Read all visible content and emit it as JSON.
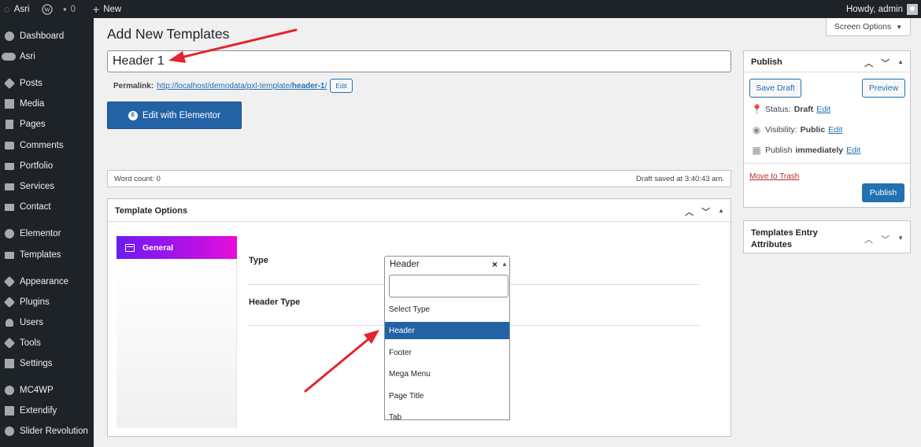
{
  "admin_bar": {
    "site_name": "Asri",
    "comment_count": "0",
    "new_label": "New",
    "howdy": "Howdy, admin"
  },
  "sidebar": {
    "items": [
      {
        "label": "Dashboard",
        "icon": "dashboard-icon"
      },
      {
        "label": "Asri",
        "icon": "toggle-icon"
      },
      {
        "label": "Posts",
        "icon": "pin-icon"
      },
      {
        "label": "Media",
        "icon": "media-icon"
      },
      {
        "label": "Pages",
        "icon": "pages-icon"
      },
      {
        "label": "Comments",
        "icon": "comments-icon"
      },
      {
        "label": "Portfolio",
        "icon": "folder-icon"
      },
      {
        "label": "Services",
        "icon": "folder-icon"
      },
      {
        "label": "Contact",
        "icon": "mail-icon"
      },
      {
        "label": "Elementor",
        "icon": "elementor-icon"
      },
      {
        "label": "Templates",
        "icon": "folder-icon"
      },
      {
        "label": "Appearance",
        "icon": "brush-icon"
      },
      {
        "label": "Plugins",
        "icon": "plug-icon"
      },
      {
        "label": "Users",
        "icon": "users-icon"
      },
      {
        "label": "Tools",
        "icon": "wrench-icon"
      },
      {
        "label": "Settings",
        "icon": "settings-icon"
      },
      {
        "label": "MC4WP",
        "icon": "mc4wp-icon"
      },
      {
        "label": "Extendify",
        "icon": "extendify-icon"
      },
      {
        "label": "Slider Revolution",
        "icon": "refresh-icon"
      }
    ]
  },
  "page": {
    "title": "Add New Templates",
    "screen_options": "Screen Options",
    "post_title_value": "Header 1",
    "permalink_label": "Permalink:",
    "permalink_base": "http://localhost/demodata/pxl-template/",
    "permalink_slug": "header-1",
    "permalink_edit": "Edit",
    "edit_with_elementor": "Edit with Elementor",
    "word_count": "Word count: 0",
    "draft_saved": "Draft saved at 3:40:43 am."
  },
  "template_options": {
    "title": "Template Options",
    "tab_general": "General",
    "type_label": "Type",
    "header_type_label": "Header Type",
    "type_value": "Header",
    "clear_symbol": "×",
    "dropdown_options": [
      "Select Type",
      "Header",
      "Footer",
      "Mega Menu",
      "Page Title",
      "Tab"
    ],
    "selected_option": "Header"
  },
  "publish": {
    "title": "Publish",
    "save_draft": "Save Draft",
    "preview": "Preview",
    "status_label": "Status:",
    "status_value": "Draft",
    "visibility_label": "Visibility:",
    "visibility_value": "Public",
    "publish_label": "Publish",
    "publish_value": "immediately",
    "edit": "Edit",
    "move_to_trash": "Move to Trash",
    "publish_button": "Publish"
  },
  "attributes": {
    "title_line1": "Templates Entry",
    "title_line2": "Attributes"
  },
  "colors": {
    "admin_dark": "#1d2327",
    "accent_blue": "#2271b1",
    "elementor_blue": "#2462a6",
    "annotation_red": "#e3242b",
    "general_tab_gradient_start": "#6a1df2",
    "general_tab_gradient_end": "#e70edb"
  }
}
